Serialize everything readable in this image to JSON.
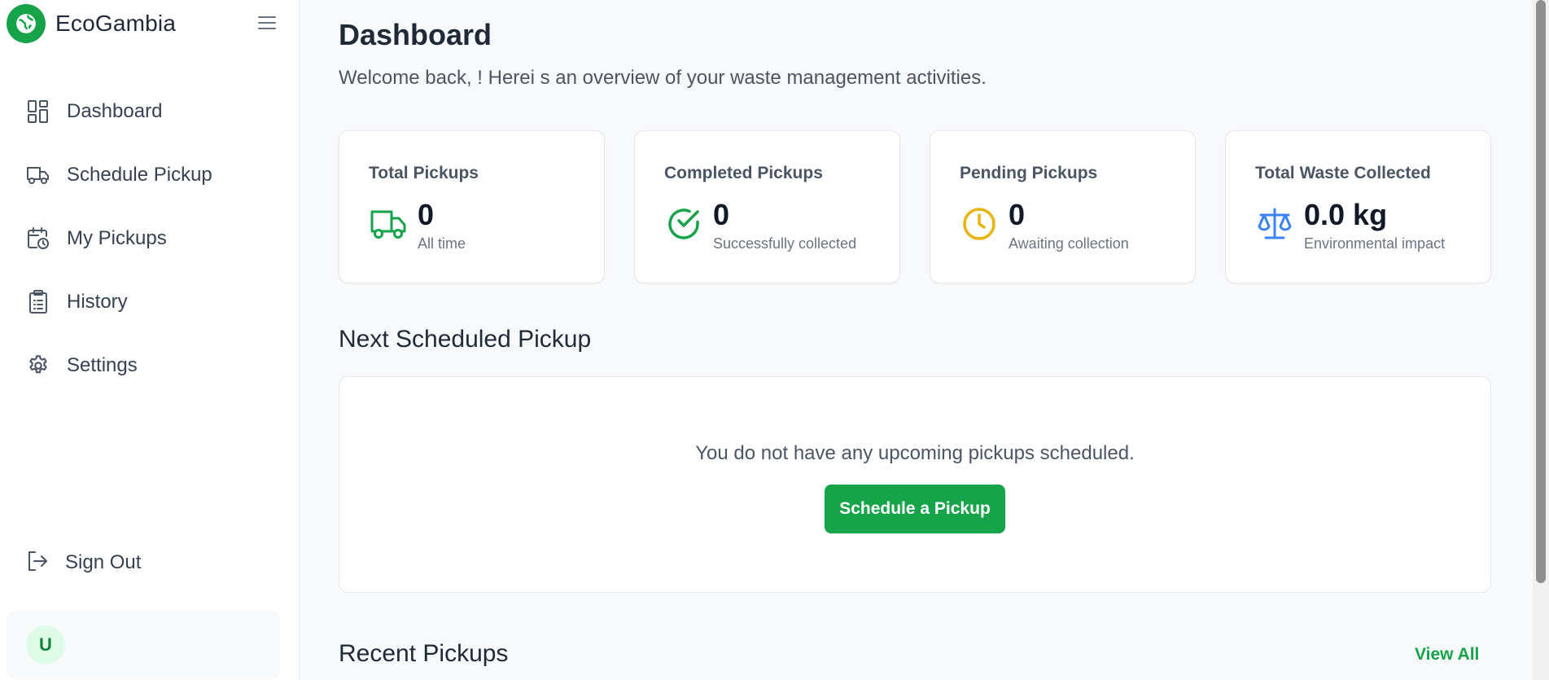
{
  "brand": {
    "name": "EcoGambia"
  },
  "sidebar": {
    "items": [
      {
        "label": "Dashboard",
        "icon": "dashboard-icon"
      },
      {
        "label": "Schedule Pickup",
        "icon": "truck-icon"
      },
      {
        "label": "My Pickups",
        "icon": "calendar-clock-icon"
      },
      {
        "label": "History",
        "icon": "clipboard-icon"
      },
      {
        "label": "Settings",
        "icon": "gear-icon"
      }
    ],
    "sign_out": "Sign Out",
    "user_initial": "U"
  },
  "main": {
    "title": "Dashboard",
    "welcome": "Welcome back, ! Herei s an overview of your waste management activities.",
    "stats": [
      {
        "label": "Total Pickups",
        "value": "0",
        "sub": "All time",
        "icon": "truck-icon",
        "color": "#16a34a"
      },
      {
        "label": "Completed Pickups",
        "value": "0",
        "sub": "Successfully collected",
        "icon": "check-circle-icon",
        "color": "#16a34a"
      },
      {
        "label": "Pending Pickups",
        "value": "0",
        "sub": "Awaiting collection",
        "icon": "clock-icon",
        "color": "#eab308"
      },
      {
        "label": "Total Waste Collected",
        "value": "0.0 kg",
        "sub": "Environmental impact",
        "icon": "scale-icon",
        "color": "#3b82f6"
      }
    ],
    "next_pickup": {
      "title": "Next Scheduled Pickup",
      "empty_text": "You do not have any upcoming pickups scheduled.",
      "button": "Schedule a Pickup"
    },
    "recent": {
      "title": "Recent Pickups",
      "view_all": "View All"
    }
  },
  "colors": {
    "accent": "#16a34a",
    "pending": "#eab308",
    "waste": "#3b82f6"
  }
}
